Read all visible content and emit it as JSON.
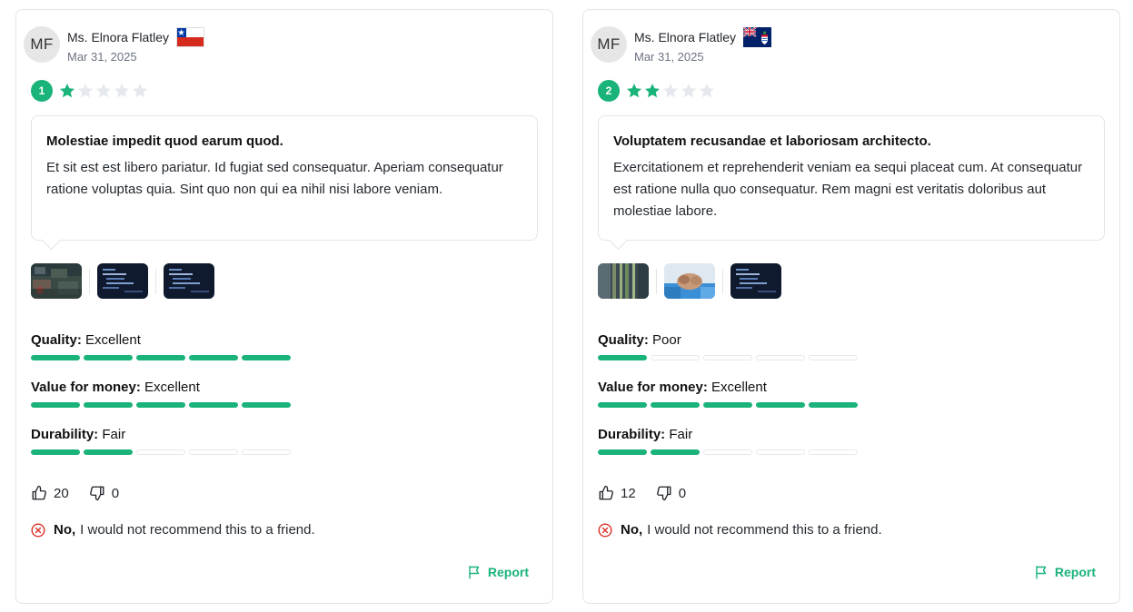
{
  "reviews": [
    {
      "author": {
        "initials": "MF",
        "name": "Ms. Elnora Flatley",
        "flag": "chile-flag"
      },
      "date": "Mar 31, 2025",
      "rating": {
        "value": "1",
        "stars": 1,
        "max": 5
      },
      "title": "Molestiae impedit quod earum quod.",
      "body": "Et sit est est libero pariatur. Id fugiat sed consequatur. Aperiam consequatur ratione voluptas quia. Sint quo non qui ea nihil nisi labore veniam.",
      "images": [
        "circuit-board-photo",
        "code-screen-photo",
        "code-screen-photo"
      ],
      "attributes": [
        {
          "label": "Quality:",
          "value": "Excellent",
          "level": 5
        },
        {
          "label": "Value for money:",
          "value": "Excellent",
          "level": 5
        },
        {
          "label": "Durability:",
          "value": "Fair",
          "level": 2
        }
      ],
      "votes": {
        "up": "20",
        "down": "0"
      },
      "recommend": {
        "answer": "No,",
        "text": "I would not recommend this to a friend."
      },
      "report_label": "Report"
    },
    {
      "author": {
        "initials": "MF",
        "name": "Ms. Elnora Flatley",
        "flag": "cayman-islands-flag"
      },
      "date": "Mar 31, 2025",
      "rating": {
        "value": "2",
        "stars": 2,
        "max": 5
      },
      "title": "Voluptatem recusandae et laboriosam architecto.",
      "body": "Exercitationem et reprehenderit veniam ea sequi placeat cum. At consequatur est ratione nulla quo consequatur. Rem magni est veritatis doloribus aut molestiae labore.",
      "images": [
        "server-cables-photo",
        "handshake-photo",
        "code-screen-photo"
      ],
      "attributes": [
        {
          "label": "Quality:",
          "value": "Poor",
          "level": 1
        },
        {
          "label": "Value for money:",
          "value": "Excellent",
          "level": 5
        },
        {
          "label": "Durability:",
          "value": "Fair",
          "level": 2
        }
      ],
      "votes": {
        "up": "12",
        "down": "0"
      },
      "recommend": {
        "answer": "No,",
        "text": "I would not recommend this to a friend."
      },
      "report_label": "Report"
    }
  ],
  "colors": {
    "accent": "#1ab37a",
    "star_empty": "#e5e9ee",
    "danger": "#d93025",
    "border": "#e1e4e8"
  },
  "attribute_max": 5
}
